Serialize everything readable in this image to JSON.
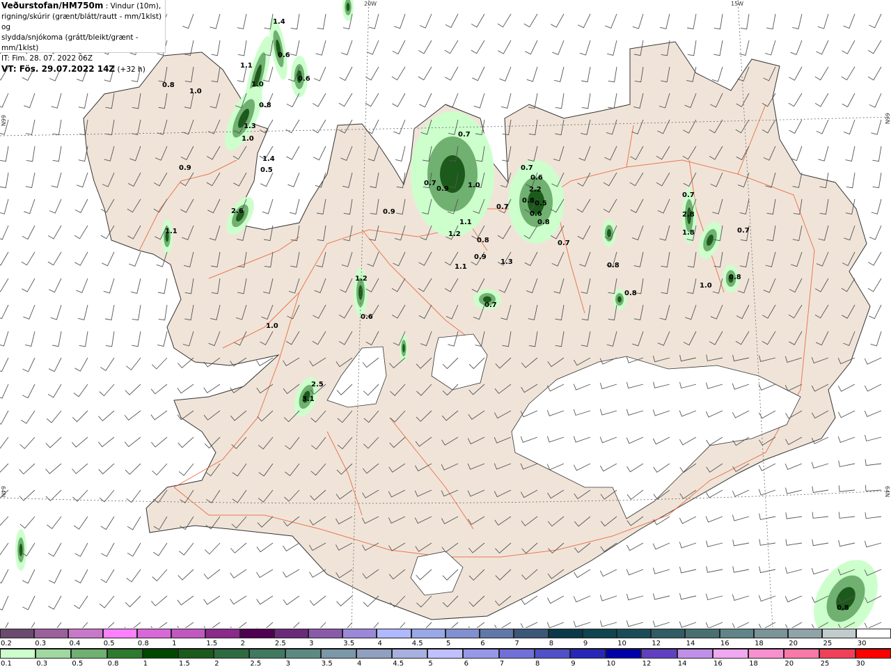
{
  "header": {
    "title": "Veðurstofan/HM750m",
    "subtitle_1": " : Vindur (10m),",
    "line_2": "rigning/skúrir (grænt/blátt/rautt - mm/1klst) og",
    "line_3": "slydda/snjókoma (grátt/bleikt/grænt - mm/1klst)",
    "initial_time": "IT: Fim. 28. 07. 2022 06Z",
    "valid_time": "VT: Fös. 29.07.2022 14Z",
    "lead": " (+32 h)"
  },
  "coord_labels": {
    "lon_20w": "20W",
    "lon_15w": "15W",
    "lat_66n_right": "66N",
    "lat_66n_left": "66N",
    "lat_64n_right": "64N",
    "lat_64n_left": "64N"
  },
  "colors": {
    "land": "#f0e4d8",
    "sea": "#ffffff",
    "glacier": "#ffffff",
    "roads": "#e8643c",
    "wind_barb": "#555555",
    "precip_light": "#ccffcc",
    "precip_heavy": "#004800"
  },
  "precip_labels": [
    "1.4",
    "0.6",
    "0.6",
    "1.1",
    "1.0",
    "0.8",
    "0.8",
    "1.0",
    "1.3",
    "1.0",
    "1.4",
    "0.5",
    "0.9",
    "2.6",
    "1.1",
    "1.0",
    "1.2",
    "0.6",
    "0.9",
    "0.7",
    "1.0",
    "0.7",
    "0.9",
    "1.2",
    "1.1",
    "0.8",
    "1.1",
    "1.3",
    "0.9",
    "0.7",
    "0.6",
    "2.2",
    "0.8",
    "0.5",
    "0.6",
    "0.8",
    "0.7",
    "0.7",
    "2.8",
    "1.8",
    "0.7",
    "0.8",
    "1.0",
    "0.8",
    "0.8",
    "0.7",
    "0.7",
    "2.5",
    "3.1",
    "0.8"
  ],
  "colorbar_sleet_snow": {
    "labels": [
      "0.2",
      "0.3",
      "0.4",
      "0.5",
      "0.8",
      "1",
      "1.5",
      "2",
      "2.5",
      "3",
      "3.5",
      "4",
      "4.5",
      "5",
      "6",
      "7",
      "8",
      "9",
      "10",
      "12",
      "14",
      "16",
      "18",
      "20",
      "25",
      "30"
    ],
    "colors": [
      "#6a4a6e",
      "#9a609c",
      "#c878c8",
      "#ff80ff",
      "#d868d8",
      "#c058c0",
      "#8a2a8a",
      "#500050",
      "#6a2a7a",
      "#8a5aaa",
      "#9a88d8",
      "#b0b8ff",
      "#98a8e8",
      "#8090d0",
      "#6078a8",
      "#3a5878",
      "#0a3a48",
      "#104450",
      "#1a4c58",
      "#305c64",
      "#487070",
      "#608488",
      "#7a9498",
      "#90a4a8",
      "#c0cccc",
      "#ffffff"
    ]
  },
  "colorbar_rain": {
    "labels": [
      "0.1",
      "0.3",
      "0.5",
      "0.8",
      "1",
      "1.5",
      "2",
      "2.5",
      "3",
      "3.5",
      "4",
      "4.5",
      "5",
      "6",
      "7",
      "8",
      "9",
      "10",
      "12",
      "14",
      "16",
      "18",
      "20",
      "25",
      "30"
    ],
    "colors": [
      "#ccffcc",
      "#a0d8a0",
      "#70b070",
      "#2e7a2e",
      "#004800",
      "#1c5a1c",
      "#2e6a40",
      "#407860",
      "#5c8a80",
      "#7a98a8",
      "#90a0c0",
      "#a8b0e0",
      "#c0c0ff",
      "#9898e8",
      "#7070d8",
      "#5050c8",
      "#2828b8",
      "#0000a8",
      "#6040c0",
      "#c090e8",
      "#f0a8f0",
      "#f890d0",
      "#f878a8",
      "#f04058",
      "#ff0000"
    ]
  }
}
